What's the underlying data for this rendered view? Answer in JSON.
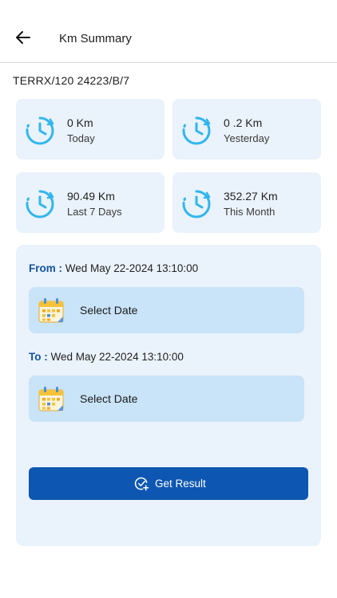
{
  "header": {
    "title": "Km Summary"
  },
  "vehicle_id": "TERRX/120 24223/B/7",
  "stats": [
    {
      "value": "0 Km",
      "label": "Today"
    },
    {
      "value": "0 .2 Km",
      "label": "Yesterday"
    },
    {
      "value": "90.49 Km",
      "label": "Last 7 Days"
    },
    {
      "value": "352.27 Km",
      "label": "This Month"
    }
  ],
  "range": {
    "from_key": "From :",
    "from_value": "Wed May 22-2024 13:10:00",
    "to_key": "To :",
    "to_value": "Wed May 22-2024 13:10:00",
    "select_from_label": "Select Date",
    "select_to_label": "Select Date"
  },
  "actions": {
    "submit_label": "Get Result"
  },
  "colors": {
    "accent": "#0d57b2",
    "card_bg": "#eaf2fb",
    "date_btn_bg": "#c9e3f8",
    "clock": "#30b6ee"
  },
  "icons": {
    "back": "arrow-left-icon",
    "clock": "clock-icon",
    "calendar": "calendar-icon",
    "submit": "check-plus-icon"
  }
}
